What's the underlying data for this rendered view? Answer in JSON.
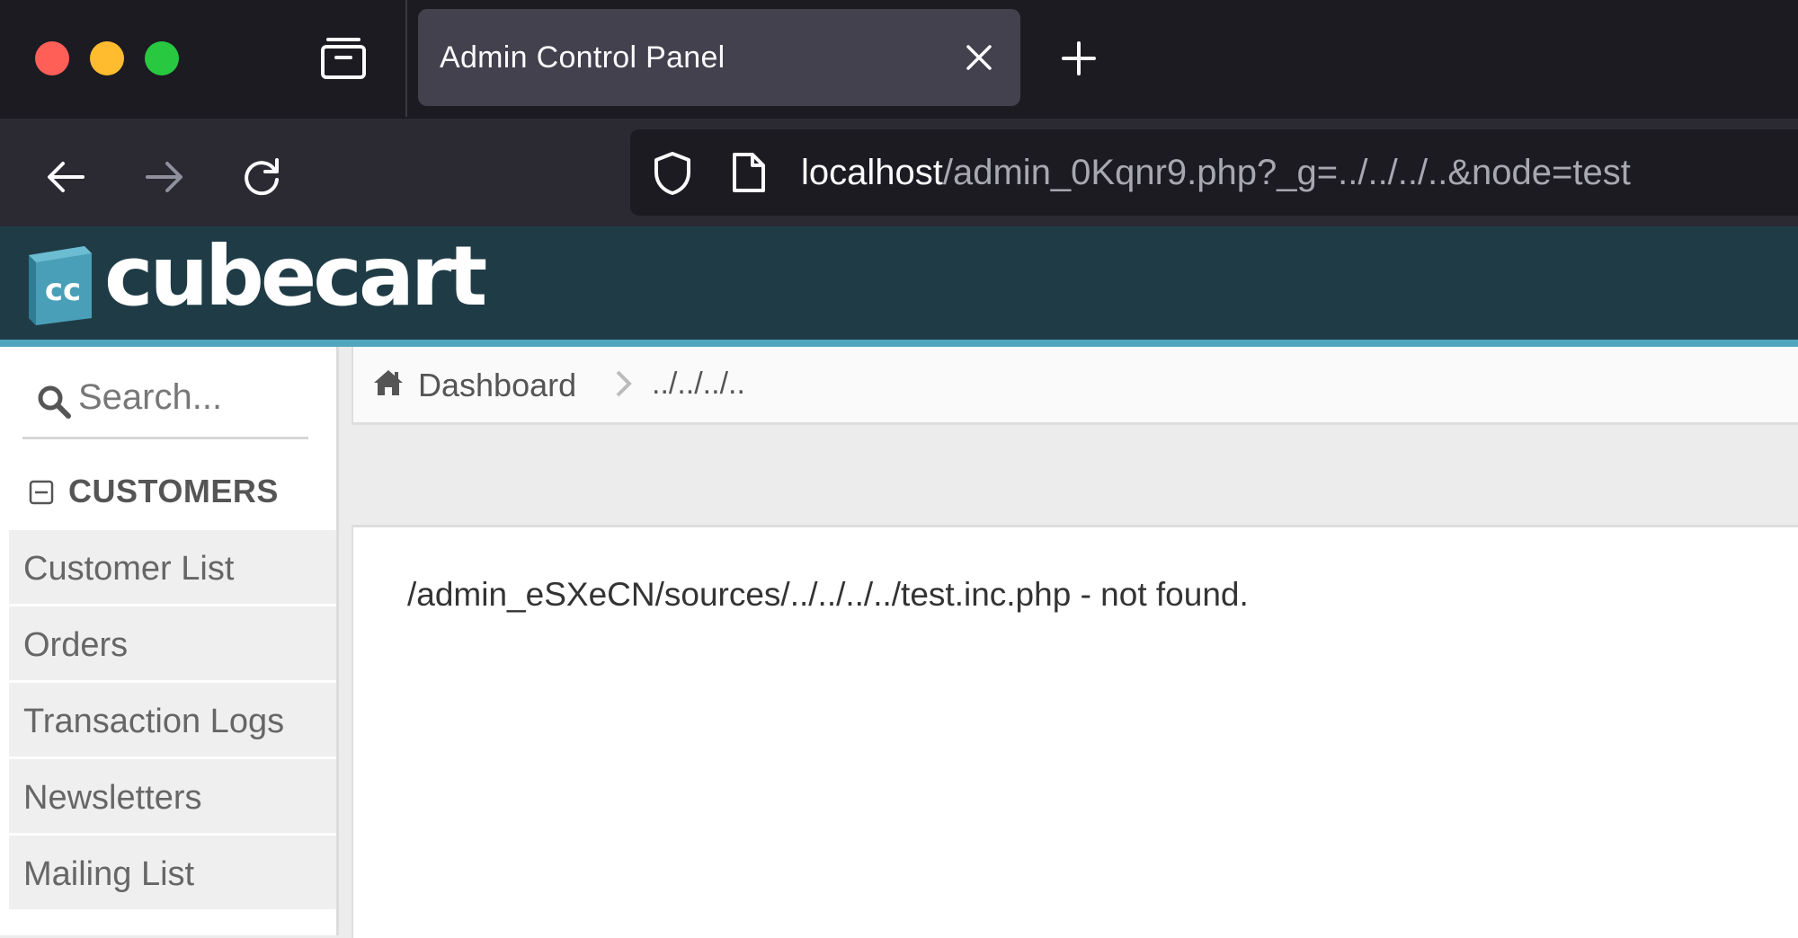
{
  "browser": {
    "tab_title": "Admin Control Panel",
    "url_host": "localhost",
    "url_path": "/admin_0Kqnr9.php?_g=../../../..&node=test"
  },
  "header": {
    "logo_text": "cubecart",
    "logo_mark": "cc",
    "colors": {
      "header_bg": "#1f3c46",
      "accent_strip": "#4fa6bd",
      "cube": "#4a9fb8"
    }
  },
  "sidebar": {
    "search_placeholder": "Search...",
    "section_title": "CUSTOMERS",
    "items": [
      {
        "label": "Customer List"
      },
      {
        "label": "Orders"
      },
      {
        "label": "Transaction Logs"
      },
      {
        "label": "Newsletters"
      },
      {
        "label": "Mailing List"
      }
    ]
  },
  "breadcrumb": {
    "home": "Dashboard",
    "current": "../../../.."
  },
  "main": {
    "message": "/admin_eSXeCN/sources/../../../../test.inc.php - not found."
  }
}
